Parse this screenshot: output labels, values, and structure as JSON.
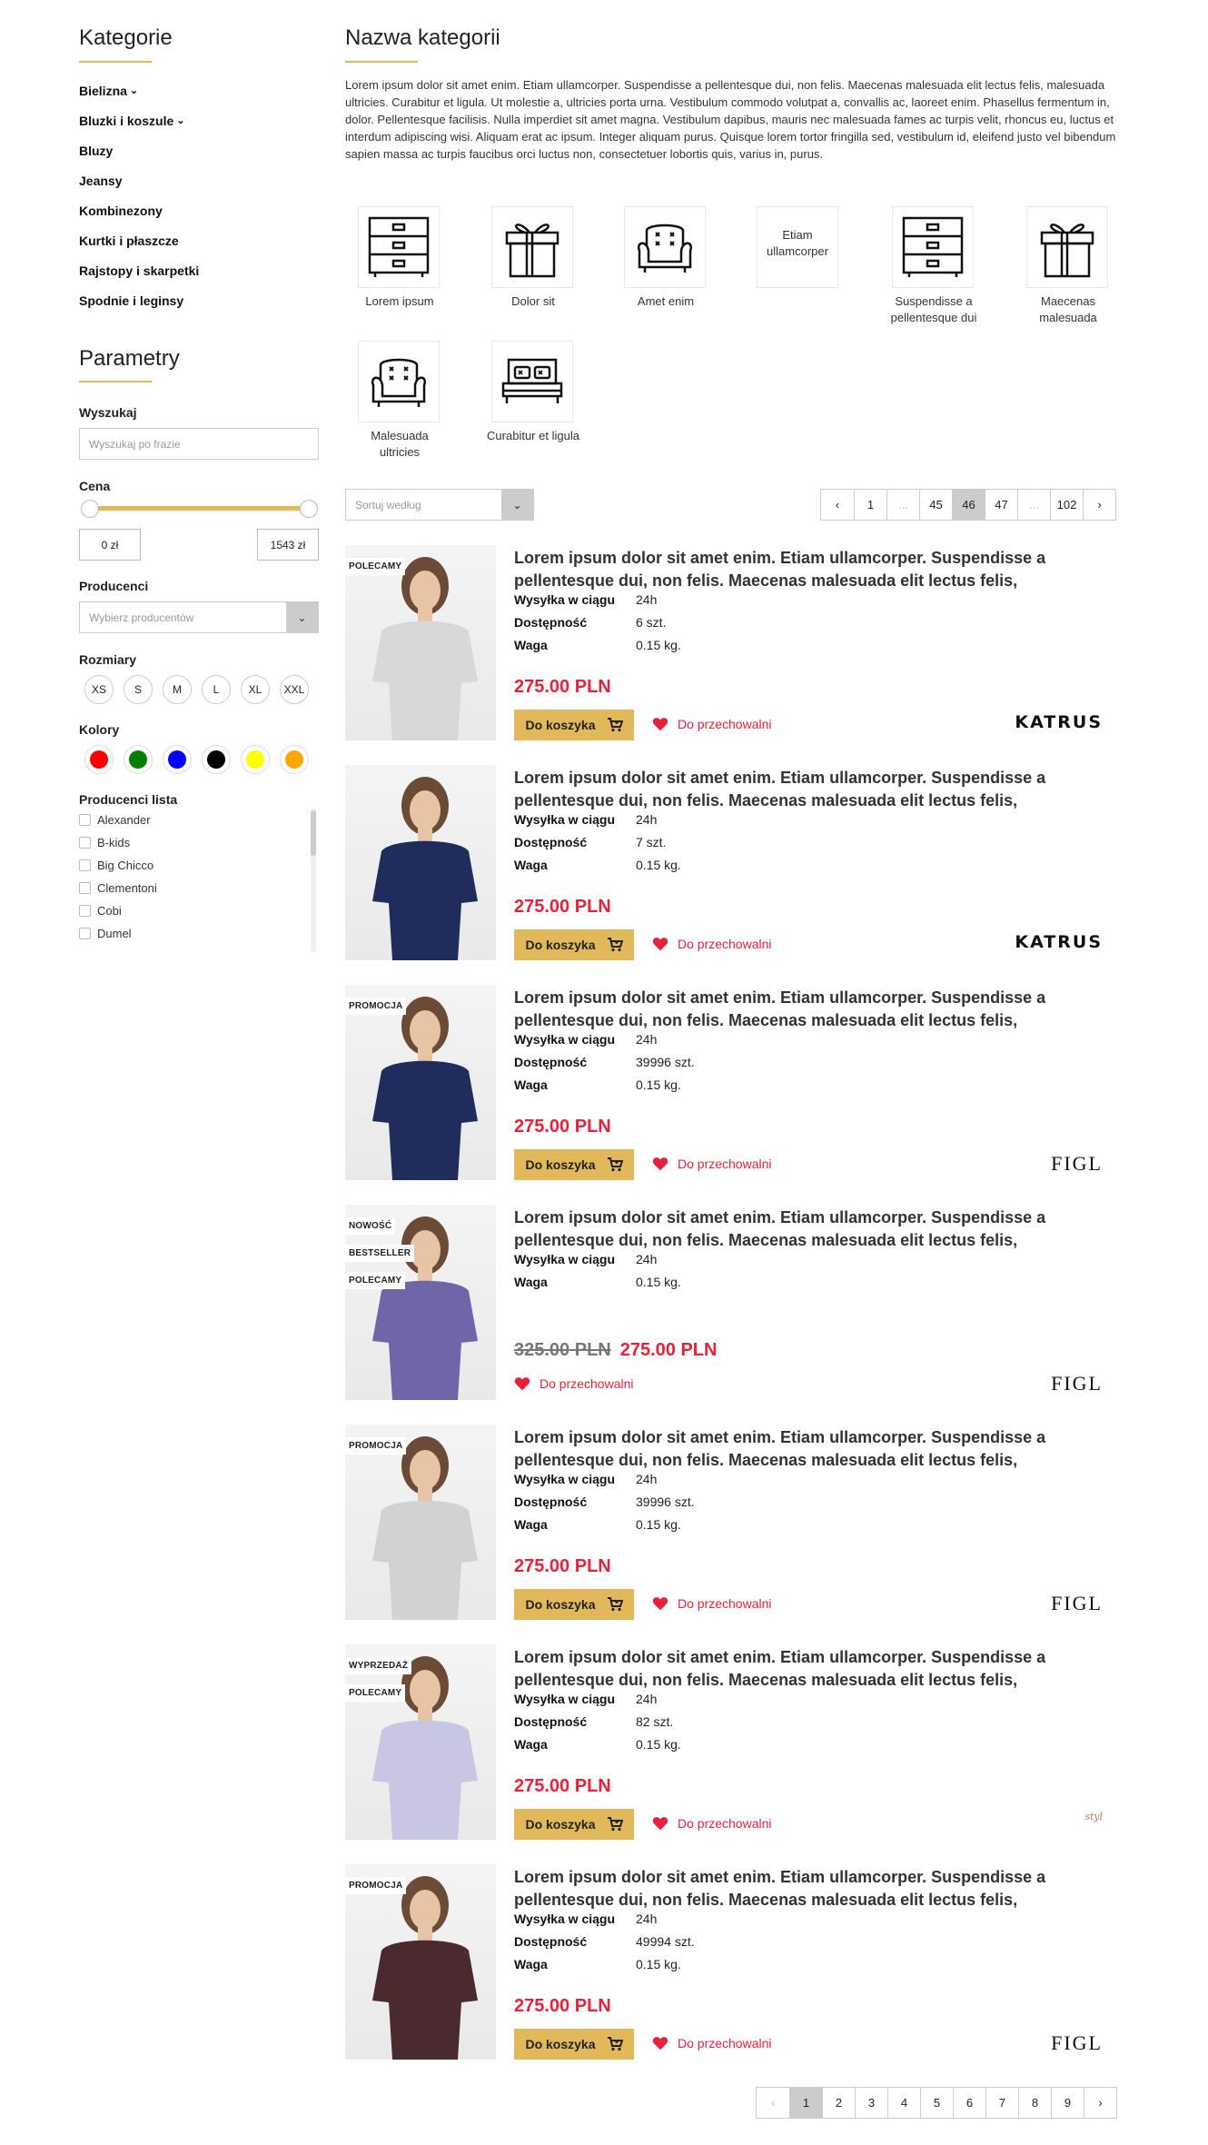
{
  "sidebar": {
    "categories_title": "Kategorie",
    "categories": [
      {
        "label": "Bielizna",
        "has_children": true
      },
      {
        "label": "Bluzki i koszule",
        "has_children": true
      },
      {
        "label": "Bluzy",
        "has_children": false
      },
      {
        "label": "Jeansy",
        "has_children": false
      },
      {
        "label": "Kombinezony",
        "has_children": false
      },
      {
        "label": "Kurtki i płaszcze",
        "has_children": false
      },
      {
        "label": "Rajstopy i skarpetki",
        "has_children": false
      },
      {
        "label": "Spodnie i leginsy",
        "has_children": false
      }
    ],
    "params_title": "Parametry",
    "search_label": "Wyszukaj",
    "search_placeholder": "Wyszukaj po frazie",
    "price_label": "Cena",
    "price_min": "0 zł",
    "price_max": "1543 zł",
    "producers_label": "Producenci",
    "producers_placeholder": "Wybierz producentów",
    "sizes_label": "Rozmiary",
    "sizes": [
      "XS",
      "S",
      "M",
      "L",
      "XL",
      "XXL"
    ],
    "colors_label": "Kolory",
    "colors": [
      "#ff0000",
      "#008000",
      "#0000ff",
      "#000000",
      "#ffff00",
      "#ffa500"
    ],
    "producer_list_label": "Producenci lista",
    "producer_list": [
      "Alexander",
      "B-kids",
      "Big Chicco",
      "Clementoni",
      "Cobi",
      "Dumel"
    ]
  },
  "main": {
    "title": "Nazwa kategorii",
    "description": "Lorem ipsum dolor sit amet enim. Etiam ullamcorper. Suspendisse a pellentesque dui, non felis. Maecenas malesuada elit lectus felis, malesuada ultricies. Curabitur et ligula. Ut molestie a, ultricies porta urna. Vestibulum commodo volutpat a, convallis ac, laoreet enim. Phasellus fermentum in, dolor. Pellentesque facilisis. Nulla imperdiet sit amet magna. Vestibulum dapibus, mauris nec malesuada fames ac turpis velit, rhoncus eu, luctus et interdum adipiscing wisi. Aliquam erat ac ipsum. Integer aliquam purus. Quisque lorem tortor fringilla sed, vestibulum id, eleifend justo vel bibendum sapien massa ac turpis faucibus orci luctus non, consectetuer lobortis quis, varius in, purus.",
    "subcategories": [
      {
        "label": "Lorem ipsum",
        "icon": "dresser-icon"
      },
      {
        "label": "Dolor sit",
        "icon": "gift-icon"
      },
      {
        "label": "Amet enim",
        "icon": "armchair-icon"
      },
      {
        "label": "Suspendisse a pellentesque dui",
        "icon": "dresser-icon"
      },
      {
        "label": "Maecenas malesuada",
        "icon": "gift-icon"
      },
      {
        "label": "Malesuada ultricies",
        "icon": "armchair-icon"
      },
      {
        "label": "Curabitur et ligula",
        "icon": "bed-icon"
      }
    ],
    "text_tile": "Etiam ullamcorper",
    "sort_placeholder": "Sortuj według",
    "pager_top": [
      "1",
      "...",
      "45",
      "46",
      "47",
      "...",
      "102"
    ],
    "pager_top_active": "46",
    "pager_bottom": [
      "1",
      "2",
      "3",
      "4",
      "5",
      "6",
      "7",
      "8",
      "9"
    ],
    "pager_bottom_active": "1"
  },
  "labels": {
    "shipping": "Wysyłka w ciągu",
    "availability": "Dostępność",
    "weight": "Waga",
    "add_to_cart": "Do koszyka",
    "wishlist": "Do przechowalni"
  },
  "products": [
    {
      "title": "Lorem ipsum dolor sit amet enim. Etiam ullamcorper. Suspendisse a pellentesque dui, non felis. Maecenas malesuada elit lectus felis, malesuada ultricies.",
      "badges": [
        "POLECAMY"
      ],
      "shipping": "24h",
      "availability": "6 szt.",
      "weight": "0.15 kg.",
      "price": "275.00 PLN",
      "brand": "KATRUS"
    },
    {
      "title": "Lorem ipsum dolor sit amet enim. Etiam ullamcorper. Suspendisse a pellentesque dui, non felis. Maecenas malesuada elit lectus felis, malesuada ultricies.",
      "badges": [],
      "shipping": "24h",
      "availability": "7 szt.",
      "weight": "0.15 kg.",
      "price": "275.00 PLN",
      "brand": "KATRUS"
    },
    {
      "title": "Lorem ipsum dolor sit amet enim. Etiam ullamcorper. Suspendisse a pellentesque dui, non felis. Maecenas malesuada elit lectus felis, malesuada ultricies.",
      "badges": [
        "PROMOCJA"
      ],
      "shipping": "24h",
      "availability": "39996 szt.",
      "weight": "0.15 kg.",
      "price": "275.00 PLN",
      "brand": "FIGL"
    },
    {
      "title": "Lorem ipsum dolor sit amet enim. Etiam ullamcorper. Suspendisse a pellentesque dui, non felis. Maecenas malesuada elit lectus felis, malesuada ultricies.",
      "badges": [
        "NOWOŚĆ",
        "BESTSELLER",
        "POLECAMY"
      ],
      "shipping": "24h",
      "weight": "0.15 kg.",
      "old_price": "325.00 PLN",
      "price": "275.00 PLN",
      "brand": "FIGL"
    },
    {
      "title": "Lorem ipsum dolor sit amet enim. Etiam ullamcorper. Suspendisse a pellentesque dui, non felis. Maecenas malesuada elit lectus felis, malesuada ultricies.",
      "badges": [
        "PROMOCJA"
      ],
      "shipping": "24h",
      "availability": "39996 szt.",
      "weight": "0.15 kg.",
      "price": "275.00 PLN",
      "brand": "FIGL"
    },
    {
      "title": "Lorem ipsum dolor sit amet enim. Etiam ullamcorper. Suspendisse a pellentesque dui, non felis. Maecenas malesuada elit lectus felis, malesuada ultricies.",
      "badges": [
        "WYPRZEDAŻ",
        "POLECAMY"
      ],
      "shipping": "24h",
      "availability": "82 szt.",
      "weight": "0.15 kg.",
      "price": "275.00 PLN",
      "brand": "styl"
    },
    {
      "title": "Lorem ipsum dolor sit amet enim. Etiam ullamcorper. Suspendisse a pellentesque dui, non felis. Maecenas malesuada elit lectus felis, malesuada ultricies.",
      "badges": [
        "PROMOCJA"
      ],
      "shipping": "24h",
      "availability": "49994 szt.",
      "weight": "0.15 kg.",
      "price": "275.00 PLN",
      "brand": "FIGL"
    }
  ]
}
